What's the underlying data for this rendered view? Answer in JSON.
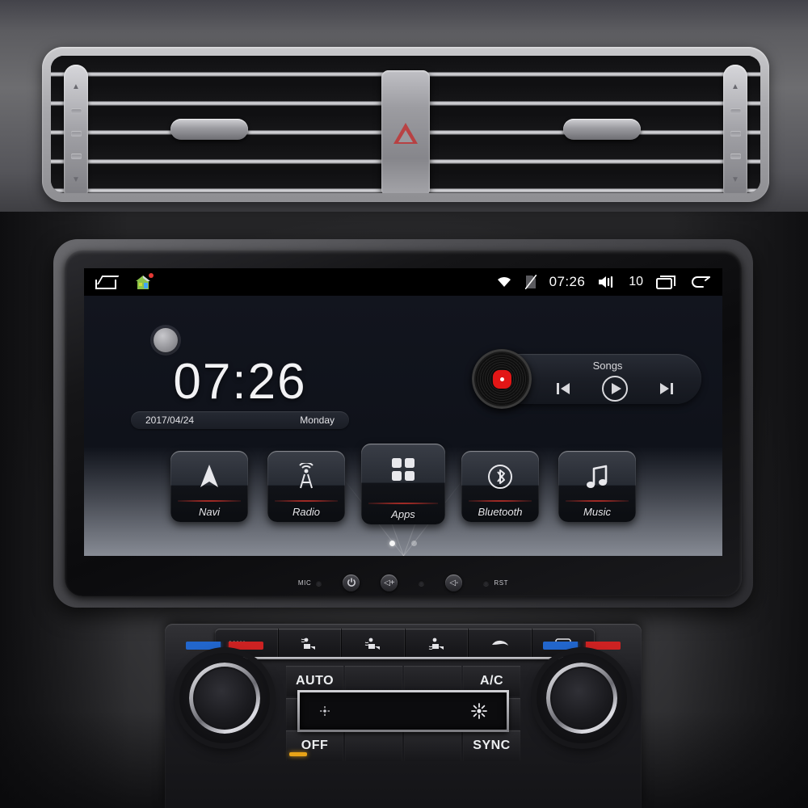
{
  "status_bar": {
    "home_icon": "home-outline-icon",
    "house_app_icon": "house-app-icon",
    "wifi_icon": "wifi-icon",
    "no_sim_icon": "no-sim-icon",
    "time": "07:26",
    "volume_icon": "volume-icon",
    "volume_level": "10",
    "recents_icon": "recents-icon",
    "back_icon": "back-arrow-icon"
  },
  "home": {
    "clock": {
      "time": "07:26",
      "date": "2017/04/24",
      "weekday": "Monday"
    },
    "music_widget": {
      "label": "Songs",
      "album_icon": "vinyl-record-icon",
      "prev_icon": "previous-track-icon",
      "play_icon": "play-icon",
      "next_icon": "next-track-icon"
    },
    "apps": [
      {
        "label": "Navi",
        "icon": "navigation-arrow-icon"
      },
      {
        "label": "Radio",
        "icon": "radio-tower-icon"
      },
      {
        "label": "Apps",
        "icon": "app-grid-icon"
      },
      {
        "label": "Bluetooth",
        "icon": "bluetooth-icon"
      },
      {
        "label": "Music",
        "icon": "music-note-icon"
      }
    ],
    "pages": {
      "count": 2,
      "active": 1
    }
  },
  "unit_buttons": {
    "mic_label": "MIC",
    "power_icon": "power-icon",
    "volume_up": "◁+",
    "volume_down": "◁-",
    "reset_label": "RST"
  },
  "climate": {
    "top_buttons": [
      {
        "label": "MAX",
        "icon": "max-defrost-icon"
      },
      {
        "label": "",
        "icon": "airflow-face-icon"
      },
      {
        "label": "",
        "icon": "airflow-face-feet-icon"
      },
      {
        "label": "",
        "icon": "airflow-feet-icon"
      },
      {
        "label": "",
        "icon": "recirculation-icon"
      },
      {
        "label": "",
        "icon": "rear-defrost-icon"
      }
    ],
    "auto_label": "AUTO",
    "ac_label": "A/C",
    "off_label": "OFF",
    "sync_label": "SYNC",
    "fan_low_icon": "fan-low-icon",
    "fan_high_icon": "fan-high-icon"
  },
  "vents": {
    "hazard_icon": "hazard-triangle-icon"
  },
  "colors": {
    "accent_red": "#ff3b30",
    "screen_bg": "#12151e",
    "status_bar_bg": "#000000",
    "temp_blue": "#2266cc",
    "temp_red": "#cc2222",
    "off_amber": "#e8a317"
  }
}
